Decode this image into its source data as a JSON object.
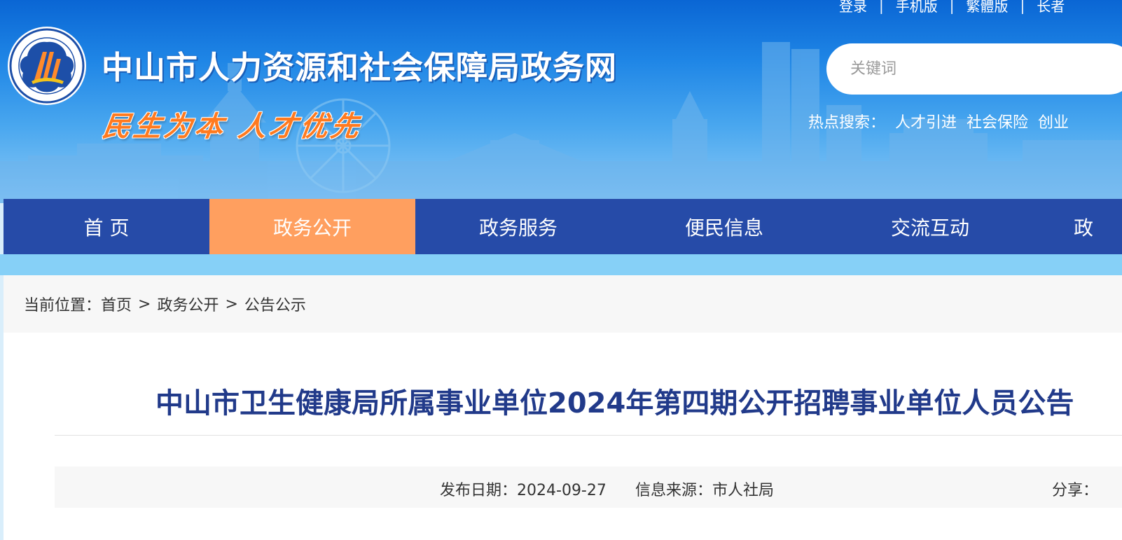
{
  "header": {
    "top_links": [
      "登录",
      "手机版",
      "繁體版",
      "长者"
    ],
    "top_link_separator": "|",
    "site_title": "中山市人力资源和社会保障局政务网",
    "slogan": "民生为本 人才优先",
    "search": {
      "placeholder": "关键词",
      "value": ""
    },
    "hot_search": {
      "label": "热点搜索：",
      "keywords": [
        "人才引进",
        "社会保险",
        "创业"
      ]
    }
  },
  "nav": {
    "items": [
      "首 页",
      "政务公开",
      "政务服务",
      "便民信息",
      "交流互动",
      "政"
    ],
    "active_index": 1
  },
  "breadcrumb": {
    "label": "当前位置：",
    "items": [
      "首页",
      "政务公开",
      "公告公示"
    ],
    "separator": ">"
  },
  "article": {
    "title": "中山市卫生健康局所属事业单位2024年第四期公开招聘事业单位人员公告",
    "publish_label": "发布日期：",
    "publish_date": "2024-09-27",
    "source_label": "信息来源：",
    "source": "市人社局",
    "share_label": "分享："
  },
  "colors": {
    "nav_background": "#264ba8",
    "nav_active": "#ff9f5f",
    "title_text": "#213a8a",
    "slogan": "#ff7a1f"
  },
  "icons": {
    "logo": "hrss-emblem-icon"
  }
}
